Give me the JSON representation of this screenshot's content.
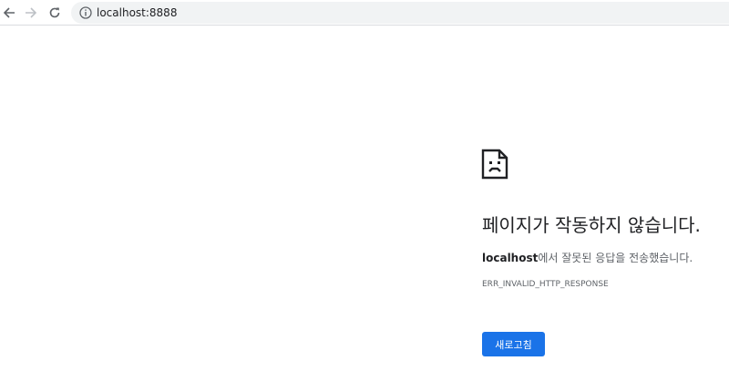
{
  "browser": {
    "url": "localhost:8888"
  },
  "icons": {
    "back": "arrow-left-icon",
    "forward": "arrow-right-icon",
    "reload": "reload-icon",
    "info": "info-circle-icon",
    "error": "sad-page-icon"
  },
  "error": {
    "title": "페이지가 작동하지 않습니다.",
    "host": "localhost",
    "description": "에서 잘못된 응답을 전송했습니다.",
    "code": "ERR_INVALID_HTTP_RESPONSE",
    "reload_label": "새로고침"
  },
  "colors": {
    "accent": "#1a73e8",
    "omnibox_bg": "#f1f3f4"
  }
}
